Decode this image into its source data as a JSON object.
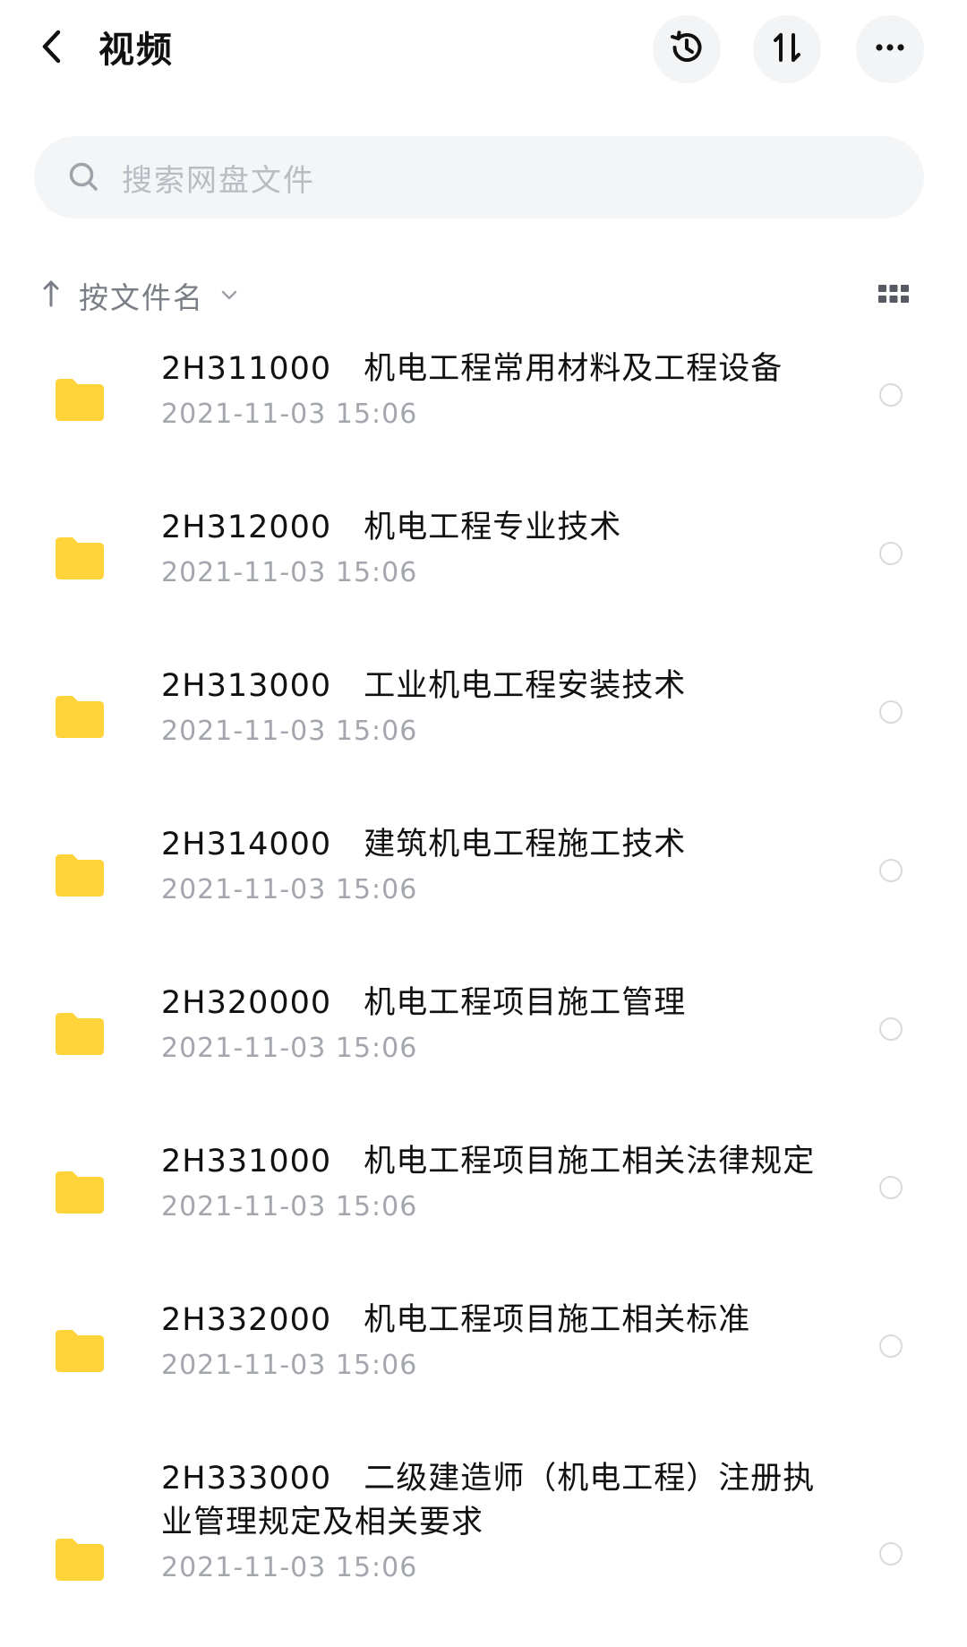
{
  "header": {
    "title": "视频",
    "back_icon": "chevron-left-icon",
    "actions": [
      {
        "name": "history",
        "icon": "history-clock-icon"
      },
      {
        "name": "sort",
        "icon": "sort-arrows-icon"
      },
      {
        "name": "more",
        "icon": "more-dots-icon"
      }
    ]
  },
  "search": {
    "placeholder": "搜索网盘文件",
    "icon": "search-icon"
  },
  "sortbar": {
    "label": "按文件名",
    "direction_icon": "arrow-up-icon",
    "dropdown_icon": "chevron-down-icon",
    "view_icon": "grid-view-icon"
  },
  "colors": {
    "folder": "#FFD43B",
    "title_text": "#111111",
    "date_text": "#A3A7AD",
    "placeholder": "#B9BCC3"
  },
  "files": [
    {
      "name": "2H311000　机电工程常用材料及工程设备",
      "date": "2021-11-03  15:06"
    },
    {
      "name": "2H312000　机电工程专业技术",
      "date": "2021-11-03  15:06"
    },
    {
      "name": "2H313000　工业机电工程安装技术",
      "date": "2021-11-03  15:06"
    },
    {
      "name": "2H314000　建筑机电工程施工技术",
      "date": "2021-11-03  15:06"
    },
    {
      "name": "2H320000　机电工程项目施工管理",
      "date": "2021-11-03  15:06"
    },
    {
      "name": "2H331000　机电工程项目施工相关法律规定",
      "date": "2021-11-03  15:06"
    },
    {
      "name": "2H332000　机电工程项目施工相关标准",
      "date": "2021-11-03  15:06"
    },
    {
      "name": "2H333000　二级建造师（机电工程）注册执业管理规定及相关要求",
      "date": "2021-11-03  15:06"
    }
  ]
}
